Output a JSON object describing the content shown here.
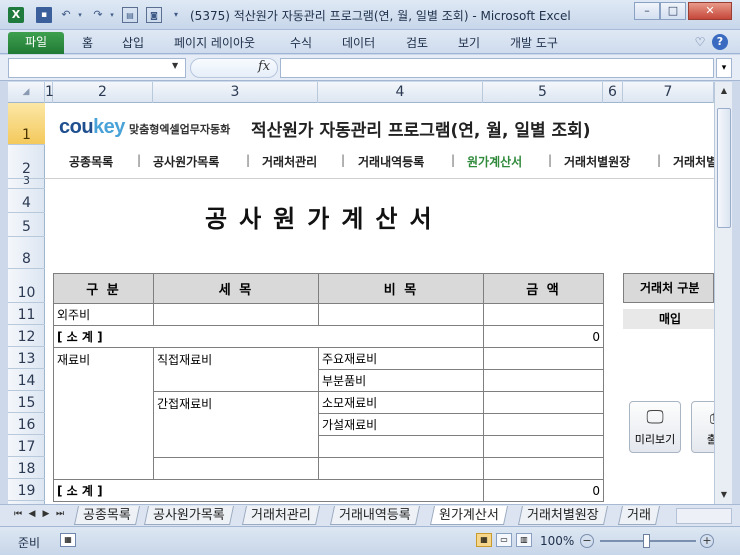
{
  "window": {
    "title": "(5375) 적산원가 자동관리 프로그램(연, 월, 일별 조회)  -  Microsoft Excel",
    "excel_logo": "X",
    "controls": {
      "minimize": "–",
      "maximize": "□",
      "close": "✕"
    }
  },
  "ribbon": {
    "tabs": [
      "파일",
      "홈",
      "삽입",
      "페이지 레이아웃",
      "수식",
      "데이터",
      "검토",
      "보기",
      "개발 도구"
    ],
    "fx_label": "fx"
  },
  "grid": {
    "columns": [
      "1",
      "2",
      "3",
      "4",
      "5",
      "6",
      "7"
    ],
    "rows": [
      "1",
      "2",
      "3",
      "4",
      "5",
      "8",
      "10",
      "11",
      "12",
      "13",
      "14",
      "15",
      "16",
      "17",
      "18",
      "19"
    ]
  },
  "header": {
    "logo_main": "cou",
    "logo_accent": "key",
    "tagline": "맞춤형엑셀업무자동화",
    "app_title": "적산원가 자동관리 프로그램(연, 월, 일별 조회)"
  },
  "nav": {
    "items": [
      "공종목록",
      "공사원가목록",
      "거래처관리",
      "거래내역등록",
      "원가계산서",
      "거래처별원장",
      "거래처별"
    ],
    "active_index": 4,
    "separator": "|"
  },
  "document": {
    "title": "공사원가계산서"
  },
  "table": {
    "headers": [
      "구 분",
      "세 목",
      "비 목",
      "금 액"
    ],
    "outsourcing": "외주비",
    "subtotal_label": "[ 소  계 ]",
    "subtotal_1": "0",
    "material": "재료비",
    "direct_material": "직접재료비",
    "main_material": "주요재료비",
    "parts": "부분품비",
    "indirect_material": "간접재료비",
    "consumables": "소모재료비",
    "temporary": "가설재료비",
    "subtotal_2": "0"
  },
  "side": {
    "header": "거래처 구분",
    "value": "매입",
    "preview_button": "미리보기",
    "print_button": "출력"
  },
  "sheet_tabs": [
    "공종목록",
    "공사원가목록",
    "거래처관리",
    "거래내역등록",
    "원가계산서",
    "거래처별원장",
    "거래"
  ],
  "active_sheet_index": 4,
  "status": {
    "ready": "준비",
    "zoom": "100%"
  }
}
